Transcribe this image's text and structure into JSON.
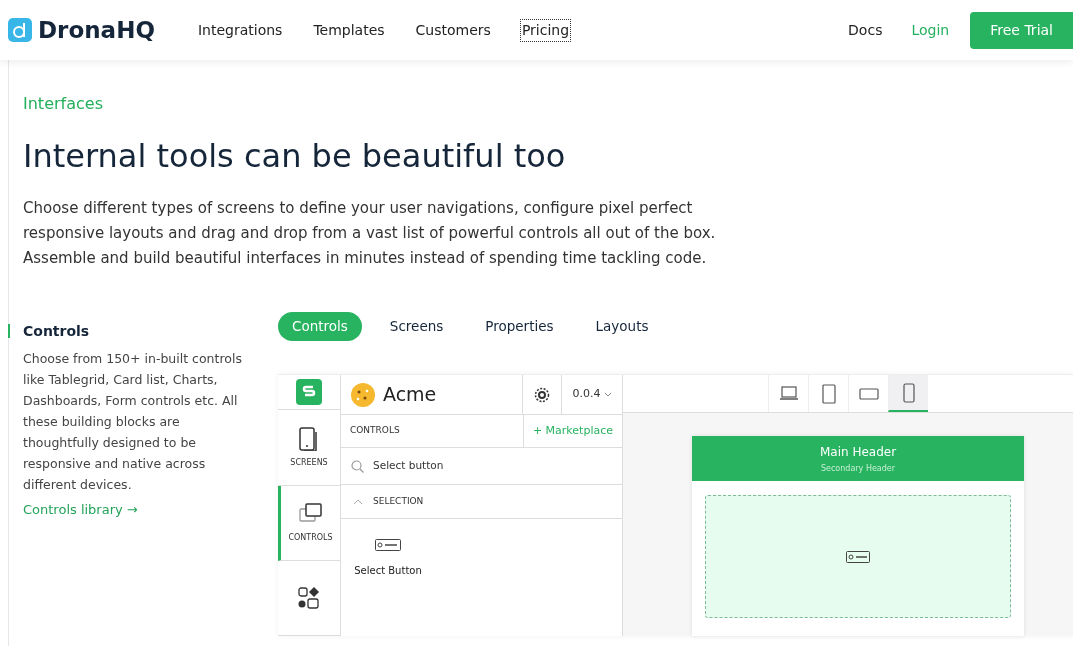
{
  "nav": {
    "logo": "DronaHQ",
    "links": [
      {
        "label": "Integrations",
        "focused": false
      },
      {
        "label": "Templates",
        "focused": false
      },
      {
        "label": "Customers",
        "focused": false
      },
      {
        "label": "Pricing",
        "focused": true
      }
    ],
    "docs": "Docs",
    "login": "Login",
    "cta": "Free Trial"
  },
  "hero": {
    "eyebrow": "Interfaces",
    "heading": "Internal tools can be beautiful too",
    "description": "Choose different types of screens to define your user navigations, configure pixel perfect responsive layouts and drag and drop from a vast list of powerful controls all out of the box. Assemble and build beautiful interfaces in minutes instead of spending time tackling code."
  },
  "feature": {
    "title": "Controls",
    "text": "Choose from 150+ in-built controls like Tablegrid, Card list, Charts, Dashboards, Form controls etc. All these building blocks are thoughtfully designed to be responsive and native across different devices.",
    "link": "Controls library →"
  },
  "tabs": [
    {
      "label": "Controls",
      "selected": true
    },
    {
      "label": "Screens",
      "selected": false
    },
    {
      "label": "Properties",
      "selected": false
    },
    {
      "label": "Layouts",
      "selected": false
    }
  ],
  "app": {
    "brand": "Acme",
    "version": "0.0.4",
    "rail": [
      {
        "kind": "screens",
        "label": "SCREENS",
        "selected": false
      },
      {
        "kind": "controls",
        "label": "CONTROLS",
        "selected": true
      },
      {
        "kind": "shapes",
        "selected": false
      }
    ],
    "panel_title": "CONTROLS",
    "marketplace": "+ Marketplace",
    "search": "Select button",
    "section": {
      "label": "SELECTION",
      "expanded": true,
      "items": [
        "Select Button"
      ]
    },
    "devices": [
      {
        "kind": "laptop",
        "selected": false
      },
      {
        "kind": "tablet",
        "selected": false
      },
      {
        "kind": "landscape",
        "selected": false
      },
      {
        "kind": "phone",
        "selected": true
      }
    ],
    "preview": {
      "main_header": "Main Header",
      "secondary_header": "Secondary Header"
    }
  }
}
